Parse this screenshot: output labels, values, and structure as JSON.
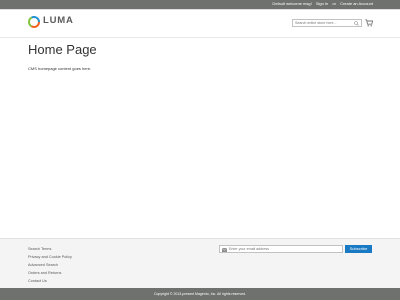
{
  "topbar": {
    "welcome": "Default welcome msg!",
    "sign_in": "Sign In",
    "or": "or",
    "create_account": "Create an Account"
  },
  "header": {
    "logo_text": "LUMA",
    "search_placeholder": "Search entire store here...",
    "icons": [
      "logo-icon",
      "search-icon",
      "cart-icon"
    ]
  },
  "main": {
    "title": "Home Page",
    "body": "CMS homepage content goes here."
  },
  "footer": {
    "links": [
      "Search Terms",
      "Privacy and Cookie Policy",
      "Advanced Search",
      "Orders and Returns",
      "Contact Us"
    ],
    "newsletter_placeholder": "Enter your email address",
    "subscribe_label": "Subscribe",
    "copyright": "Copyright © 2013-present Magento, Inc. All rights reserved."
  },
  "colors": {
    "topbar": "#6e716e",
    "accent": "#1979c3",
    "footer_bg": "#f4f4f4",
    "logo_orange": "#f26322",
    "logo_green": "#84c341",
    "logo_blue": "#2392d0"
  }
}
